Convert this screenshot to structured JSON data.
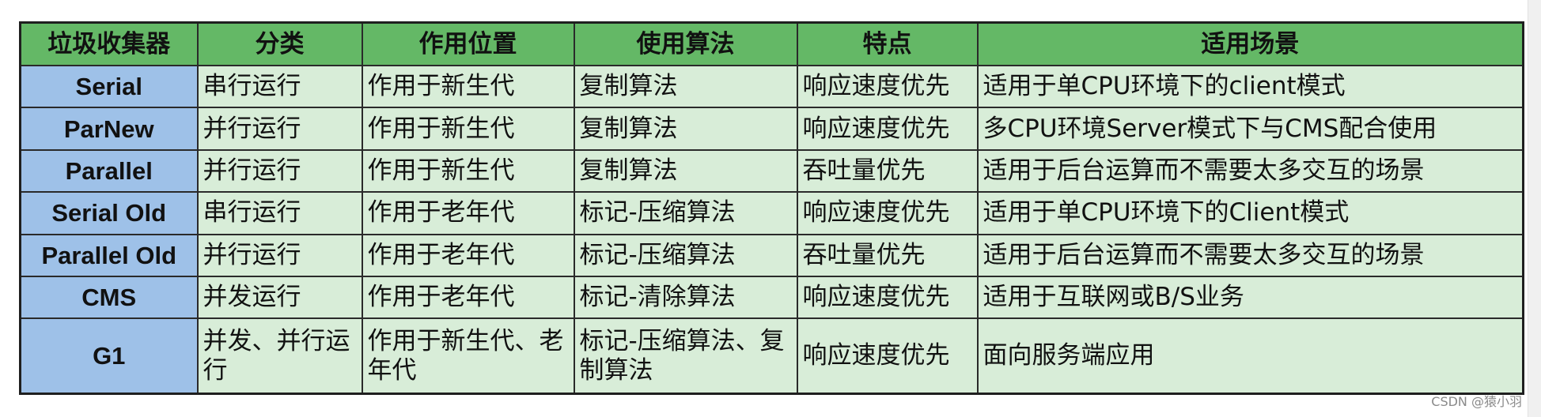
{
  "table": {
    "headers": [
      "垃圾收集器",
      "分类",
      "作用位置",
      "使用算法",
      "特点",
      "适用场景"
    ],
    "rows": [
      {
        "name": "Serial",
        "category": "串行运行",
        "position": "作用于新生代",
        "algorithm": "复制算法",
        "feature": "响应速度优先",
        "scenario": "适用于单CPU环境下的client模式"
      },
      {
        "name": "ParNew",
        "category": "并行运行",
        "position": "作用于新生代",
        "algorithm": "复制算法",
        "feature": "响应速度优先",
        "scenario": "多CPU环境Server模式下与CMS配合使用"
      },
      {
        "name": "Parallel",
        "category": "并行运行",
        "position": "作用于新生代",
        "algorithm": "复制算法",
        "feature": "吞吐量优先",
        "scenario": "适用于后台运算而不需要太多交互的场景"
      },
      {
        "name": "Serial Old",
        "category": "串行运行",
        "position": "作用于老年代",
        "algorithm": "标记-压缩算法",
        "feature": "响应速度优先",
        "scenario": "适用于单CPU环境下的Client模式"
      },
      {
        "name": "Parallel Old",
        "category": "并行运行",
        "position": "作用于老年代",
        "algorithm": "标记-压缩算法",
        "feature": "吞吐量优先",
        "scenario": "适用于后台运算而不需要太多交互的场景"
      },
      {
        "name": "CMS",
        "category": "并发运行",
        "position": "作用于老年代",
        "algorithm": "标记-清除算法",
        "feature": "响应速度优先",
        "scenario": "适用于互联网或B/S业务"
      },
      {
        "name": "G1",
        "category": "并发、并行运行",
        "position": "作用于新生代、老年代",
        "algorithm": "标记-压缩算法、复制算法",
        "feature": "响应速度优先",
        "scenario": "面向服务端应用"
      }
    ]
  },
  "watermark": "CSDN @猿小羽",
  "colors": {
    "header_bg": "#64b866",
    "name_cell_bg": "#9ec1e8",
    "body_cell_bg": "#d8edd8"
  }
}
